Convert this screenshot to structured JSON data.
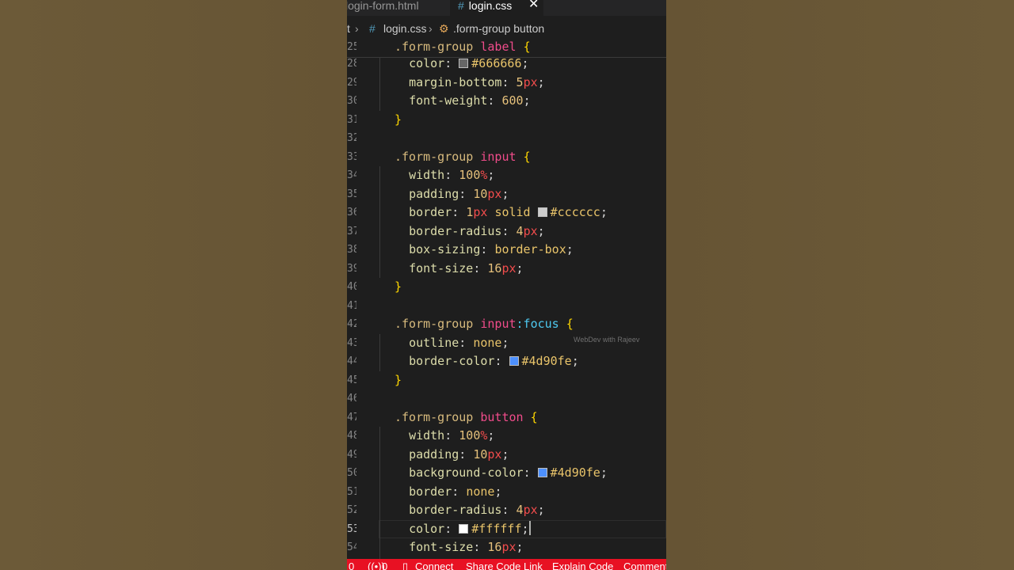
{
  "tabs": [
    {
      "label": "login-form.html"
    },
    {
      "label": "login.css",
      "close": "✕"
    }
  ],
  "breadcrumb": {
    "root": "t",
    "file": "login.css",
    "symbol": ".form-group button"
  },
  "sticky": {
    "line": "25",
    "selector": ".form-group",
    "element": "label",
    "brace": "{"
  },
  "lines": [
    {
      "n": "28",
      "prop": "color",
      "color": "#666666",
      "hex": "#666666"
    },
    {
      "n": "29",
      "prop": "margin-bottom",
      "num": "5",
      "unit": "px"
    },
    {
      "n": "30",
      "prop": "font-weight",
      "num": "600"
    },
    {
      "n": "31",
      "brace": "}"
    },
    {
      "n": "32"
    },
    {
      "n": "33",
      "selector": ".form-group",
      "element": "input",
      "brace": "{"
    },
    {
      "n": "34",
      "prop": "width",
      "num": "100",
      "unit": "%"
    },
    {
      "n": "35",
      "prop": "padding",
      "num": "10",
      "unit": "px"
    },
    {
      "n": "36",
      "prop": "border",
      "num": "1",
      "unit": "px",
      "val": "solid",
      "color": "#cccccc",
      "hex": "#cccccc"
    },
    {
      "n": "37",
      "prop": "border-radius",
      "num": "4",
      "unit": "px"
    },
    {
      "n": "38",
      "prop": "box-sizing",
      "val": "border-box"
    },
    {
      "n": "39",
      "prop": "font-size",
      "num": "16",
      "unit": "px"
    },
    {
      "n": "40",
      "brace": "}"
    },
    {
      "n": "41"
    },
    {
      "n": "42",
      "selector": ".form-group",
      "element": "input",
      "pseudo": ":focus",
      "brace": "{"
    },
    {
      "n": "43",
      "prop": "outline",
      "val": "none"
    },
    {
      "n": "44",
      "prop": "border-color",
      "color": "#4d90fe",
      "hex": "#4d90fe"
    },
    {
      "n": "45",
      "brace": "}"
    },
    {
      "n": "46"
    },
    {
      "n": "47",
      "selector": ".form-group",
      "element": "button",
      "brace": "{"
    },
    {
      "n": "48",
      "prop": "width",
      "num": "100",
      "unit": "%"
    },
    {
      "n": "49",
      "prop": "padding",
      "num": "10",
      "unit": "px"
    },
    {
      "n": "50",
      "prop": "background-color",
      "color": "#4d90fe",
      "hex": "#4d90fe"
    },
    {
      "n": "51",
      "prop": "border",
      "val": "none"
    },
    {
      "n": "52",
      "prop": "border-radius",
      "num": "4",
      "unit": "px"
    },
    {
      "n": "53",
      "prop": "color",
      "color": "#ffffff",
      "hex": "#ffffff",
      "current": true
    },
    {
      "n": "54",
      "prop": "font-size",
      "num": "16",
      "unit": "px"
    }
  ],
  "watermark": "WebDev with Rajeev",
  "status": {
    "errors": "0",
    "ports": "0",
    "connect": "Connect",
    "share": "Share Code Link",
    "explain": "Explain Code",
    "comment": "Comment"
  },
  "colors": {
    "accent": "#e81123",
    "editor_bg": "#1e1e1e",
    "backdrop": "#6a5737"
  }
}
